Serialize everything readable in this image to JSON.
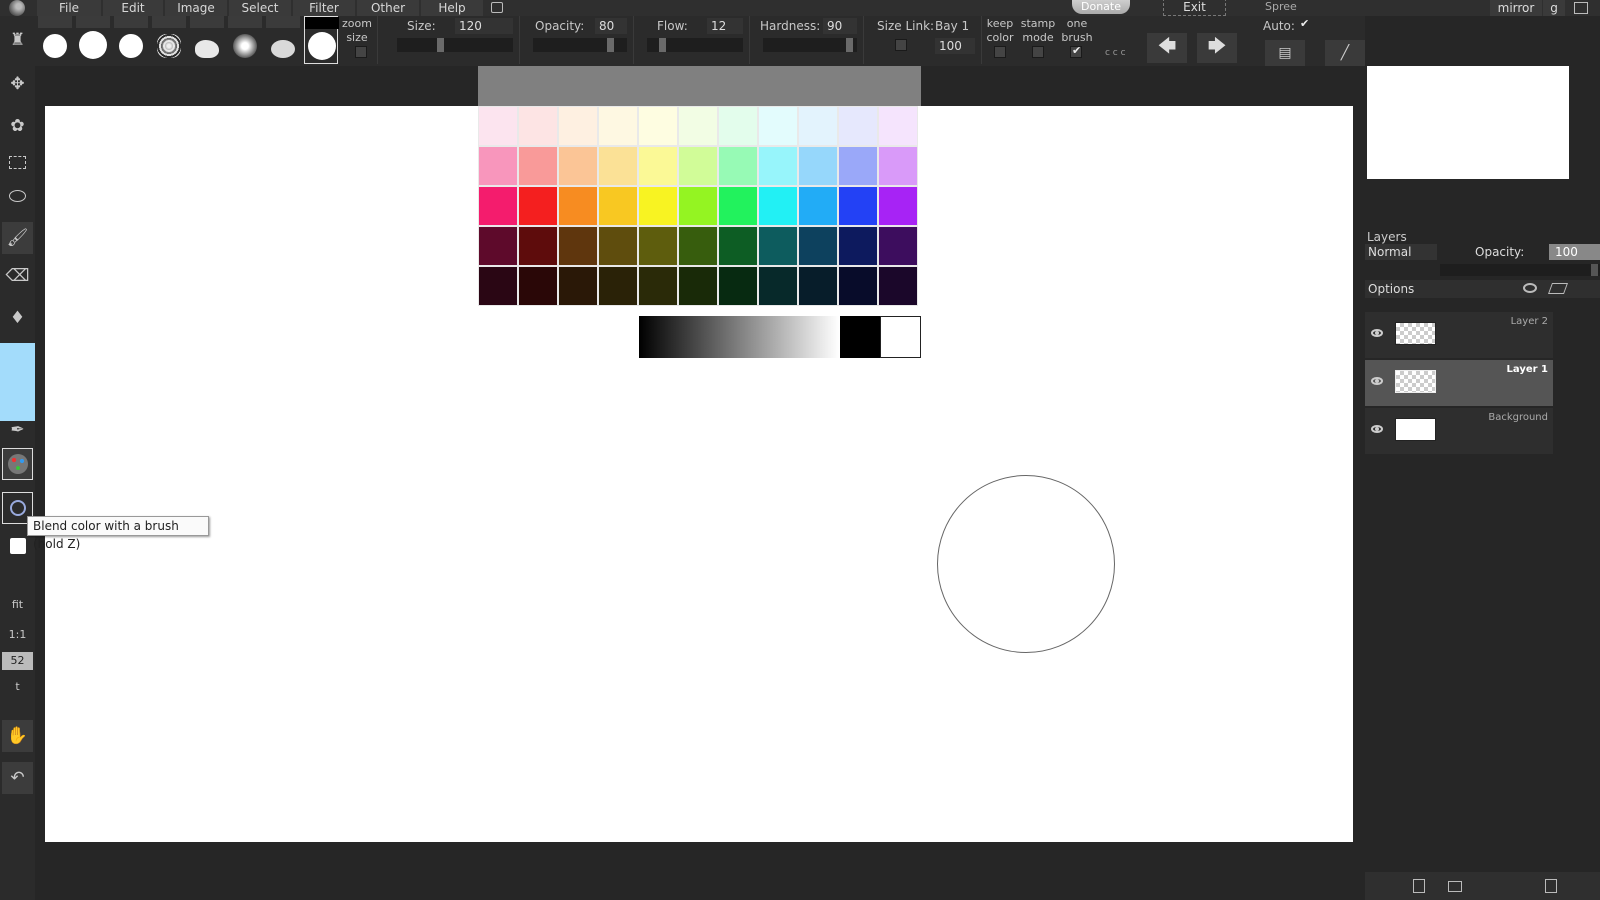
{
  "menubar": {
    "items": [
      "File",
      "Edit",
      "Image",
      "Select",
      "Filter",
      "Other",
      "Help"
    ],
    "donate": "Donate",
    "exit": "Exit",
    "spree_label": "Spree",
    "mirror": "mirror",
    "g": "g"
  },
  "options": {
    "zoom_size_label": "zoom size",
    "size_label": "Size:",
    "size_value": "120",
    "opacity_label": "Opacity:",
    "opacity_value": "80",
    "flow_label": "Flow:",
    "flow_value": "12",
    "hardness_label": "Hardness:",
    "hardness_value": "90",
    "size_link_label": "Size Link:",
    "bay_label": "Bay 1",
    "bay_value": "100",
    "keep_color_label": "keep color",
    "stamp_mode_label": "stamp mode",
    "one_brush_label": "one brush",
    "one_brush_checked": true,
    "auto_label": "Auto:",
    "auto_checked": true,
    "dots": "c c c"
  },
  "toolbar": {
    "fit": "fit",
    "one_to_one": "1:1",
    "zoom": "52",
    "t": "t",
    "current_color": "#a3dcfb"
  },
  "tooltip": "Blend color with a brush (hold Z)",
  "palette": {
    "rows": [
      [
        "#fce4ef",
        "#fde4e4",
        "#fef0e1",
        "#fef8e2",
        "#fefde1",
        "#f2fde4",
        "#e3fdec",
        "#e3fcfd",
        "#e3f3fd",
        "#e6e8fd",
        "#f5e4fd"
      ],
      [
        "#f896bc",
        "#f99a99",
        "#fbc596",
        "#fbe196",
        "#fbf996",
        "#d1fc98",
        "#97fab5",
        "#97f5fb",
        "#96d7fb",
        "#9aa8f9",
        "#d99af9"
      ],
      [
        "#f41c6d",
        "#f41f1f",
        "#f78c21",
        "#f8c822",
        "#f8f322",
        "#94f422",
        "#22f25d",
        "#22f0f4",
        "#22acf6",
        "#2341f5",
        "#a723f5"
      ],
      [
        "#5e0a2b",
        "#5e0c0c",
        "#5f360d",
        "#5f4d0d",
        "#5e5d0d",
        "#375d0d",
        "#0d5d24",
        "#0d5c5e",
        "#0d415e",
        "#0d1a5e",
        "#3d0d5e"
      ],
      [
        "#2a0614",
        "#2a0707",
        "#2a1807",
        "#2a2207",
        "#2a2a08",
        "#192a08",
        "#072a11",
        "#07292a",
        "#071d2a",
        "#080c2a",
        "#1b072a"
      ]
    ]
  },
  "layers": {
    "title": "Layers",
    "blend_mode": "Normal",
    "opacity_label": "Opacity:",
    "opacity_value": "100",
    "options_label": "Options",
    "items": [
      {
        "name": "Layer 2",
        "selected": false
      },
      {
        "name": "Layer 1",
        "selected": true
      },
      {
        "name": "Background",
        "selected": false
      }
    ]
  }
}
